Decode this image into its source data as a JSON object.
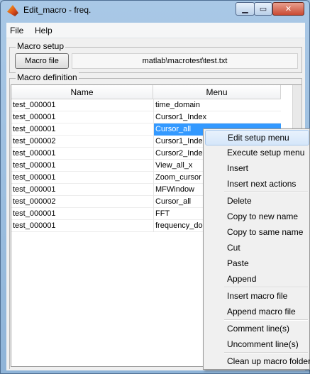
{
  "window": {
    "title": "Edit_macro - freq."
  },
  "menubar": {
    "file": "File",
    "help": "Help"
  },
  "macro_setup": {
    "legend": "Macro setup",
    "button": "Macro file",
    "path": "matlab\\macrotest\\test.txt"
  },
  "macro_definition": {
    "legend": "Macro definition",
    "columns": [
      "Name",
      "Menu"
    ],
    "rows": [
      {
        "name": "test_000001",
        "menu": "time_domain"
      },
      {
        "name": "test_000001",
        "menu": "Cursor1_Index"
      },
      {
        "name": "test_000001",
        "menu": "Cursor_all",
        "selected": true
      },
      {
        "name": "test_000002",
        "menu": "Cursor1_Index"
      },
      {
        "name": "test_000001",
        "menu": "Cursor2_Index"
      },
      {
        "name": "test_000001",
        "menu": "View_all_x"
      },
      {
        "name": "test_000001",
        "menu": "Zoom_cursor"
      },
      {
        "name": "test_000001",
        "menu": "MFWindow"
      },
      {
        "name": "test_000002",
        "menu": "Cursor_all"
      },
      {
        "name": "test_000001",
        "menu": "FFT"
      },
      {
        "name": "test_000001",
        "menu": "frequency_domain"
      }
    ]
  },
  "context_menu": {
    "items": [
      "Edit setup menu",
      "Execute setup menu",
      "Insert",
      "Insert next actions",
      "Delete",
      "Copy to new name",
      "Copy to same name",
      "Cut",
      "Paste",
      "Append",
      "Insert macro file",
      "Append macro file",
      "Comment line(s)",
      "Uncomment line(s)",
      "Clean up macro folder"
    ]
  },
  "colors": {
    "selection": "#3399ff",
    "menu_hover": "#d5e6fa"
  }
}
